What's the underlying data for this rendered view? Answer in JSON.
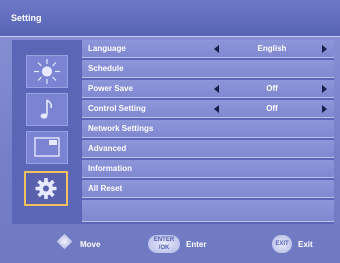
{
  "header": {
    "title": "Setting"
  },
  "icons": [
    {
      "name": "picture-brightness-icon"
    },
    {
      "name": "sound-music-note-icon"
    },
    {
      "name": "screen-display-icon"
    },
    {
      "name": "settings-gear-icon"
    }
  ],
  "menu": {
    "items": [
      {
        "label": "Language",
        "value": "English"
      },
      {
        "label": "Schedule"
      },
      {
        "label": "Power Save",
        "value": "Off"
      },
      {
        "label": "Control Setting",
        "value": "Off"
      },
      {
        "label": "Network Settings"
      },
      {
        "label": "Advanced"
      },
      {
        "label": "Information"
      },
      {
        "label": "All Reset"
      },
      {
        "label": ""
      }
    ]
  },
  "footer": {
    "move_label": "Move",
    "enter_button": "ENTER /OK",
    "enter_label": "Enter",
    "exit_button": "EXIT",
    "exit_label": "Exit"
  },
  "colors": {
    "background": "#7680c8",
    "panel": "#5c66b6",
    "row": "#8a92d6",
    "active_icon_border": "#f1c25c",
    "arrow": "#1a1f4c"
  }
}
